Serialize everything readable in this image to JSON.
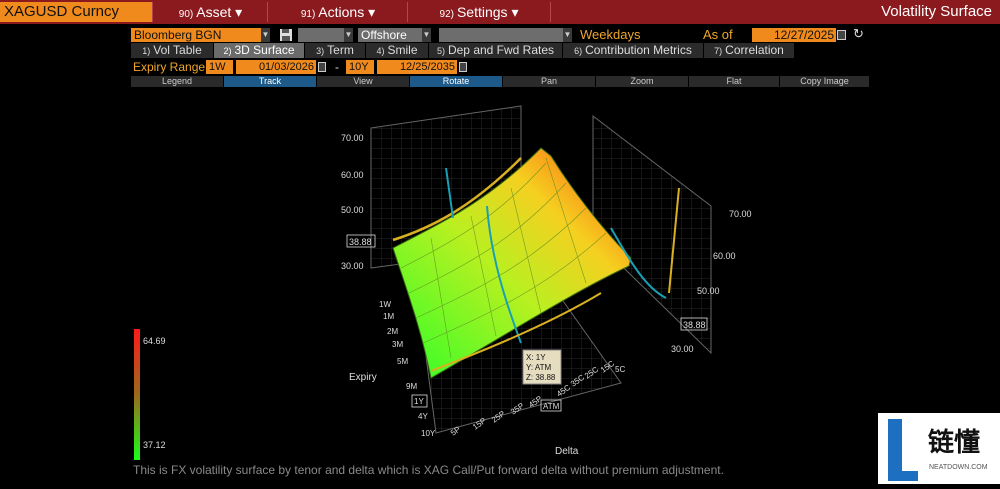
{
  "header": {
    "ticker": "XAGUSD Curncy",
    "menus": [
      {
        "num": "90)",
        "label": "Asset"
      },
      {
        "num": "91)",
        "label": "Actions"
      },
      {
        "num": "92)",
        "label": "Settings"
      }
    ],
    "title": "Volatility Surface"
  },
  "controls": {
    "source": "Bloomberg BGN",
    "location": "Offshore",
    "day_count": "Weekdays",
    "as_of_label": "As of",
    "as_of_date": "12/27/2025"
  },
  "tabs": [
    {
      "num": "1)",
      "label": "Vol Table"
    },
    {
      "num": "2)",
      "label": "3D Surface"
    },
    {
      "num": "3)",
      "label": "Term"
    },
    {
      "num": "4)",
      "label": "Smile"
    },
    {
      "num": "5)",
      "label": "Dep and Fwd Rates"
    },
    {
      "num": "6)",
      "label": "Contribution Metrics"
    },
    {
      "num": "7)",
      "label": "Correlation"
    }
  ],
  "expiry": {
    "label": "Expiry Range",
    "start_tenor": "1W",
    "start_date": "01/03/2026",
    "separator": "-",
    "end_tenor": "10Y",
    "end_date": "12/25/2035"
  },
  "toolbar": [
    "Legend",
    "Track",
    "View",
    "Rotate",
    "Pan",
    "Zoom",
    "Flat",
    "Copy Image"
  ],
  "chart_data": {
    "type": "surface",
    "axis_z_ticks": [
      "70.00",
      "60.00",
      "50.00",
      "30.00"
    ],
    "axis_z_marker": "38.88",
    "side_ticks": [
      "70.00",
      "60.00",
      "50.00",
      "30.00"
    ],
    "side_marker": "38.88",
    "expiry_label": "Expiry",
    "expiry_ticks": [
      "1W",
      "1M",
      "2M",
      "3M",
      "5M",
      "9M",
      "1Y",
      "4Y",
      "10Y"
    ],
    "expiry_highlight": "1Y",
    "delta_label": "Delta",
    "delta_ticks": [
      "5P",
      "15P",
      "25P",
      "35P",
      "45P",
      "ATM",
      "45C",
      "35C",
      "25C",
      "15C",
      "5C"
    ],
    "delta_highlight": "ATM",
    "colorbar_max": "64.69",
    "colorbar_min": "37.12",
    "tooltip": {
      "x": "X: 1Y",
      "y": "Y: ATM",
      "z": "Z: 38.88"
    }
  },
  "footer": "This is FX volatility surface by tenor and delta which is XAG Call/Put forward delta without premium adjustment.",
  "watermark": {
    "text": "链懂",
    "sub": "NEATDOWN.COM"
  }
}
